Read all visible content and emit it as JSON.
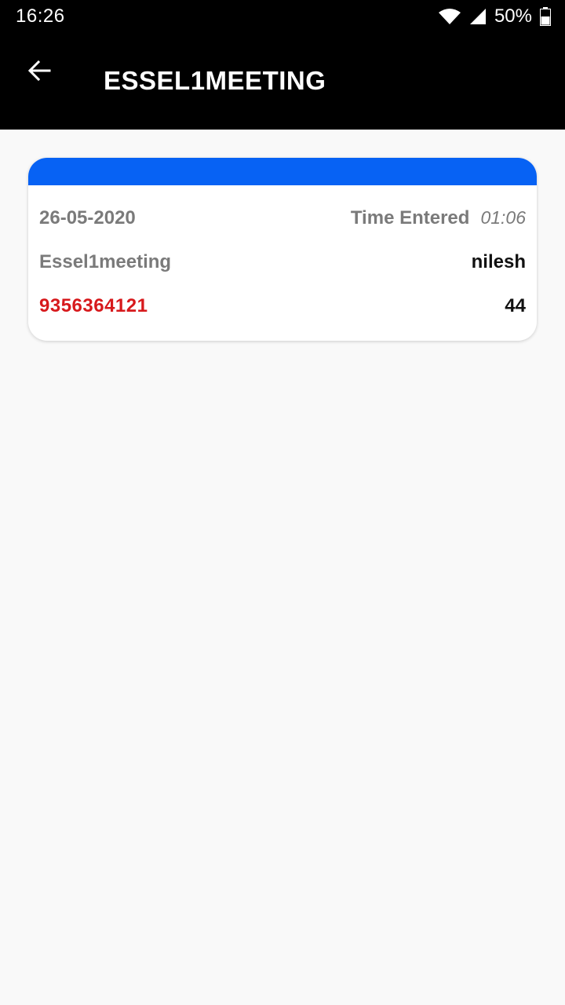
{
  "status_bar": {
    "time": "16:26",
    "battery_percent": "50%",
    "icons": [
      "wifi-icon",
      "cell-signal-icon",
      "battery-icon"
    ]
  },
  "app_bar": {
    "title": "ESSEL1MEETING",
    "back_icon": "arrow-left-icon"
  },
  "card": {
    "accent_color": "#0762f4",
    "date": "26-05-2020",
    "time_label": "Time Entered",
    "time_value": "01:06",
    "meeting_name": "Essel1meeting",
    "user_name": "nilesh",
    "phone": "9356364121",
    "count": "44"
  },
  "colors": {
    "phone_text": "#d7191c",
    "background": "#f9f9f9"
  }
}
